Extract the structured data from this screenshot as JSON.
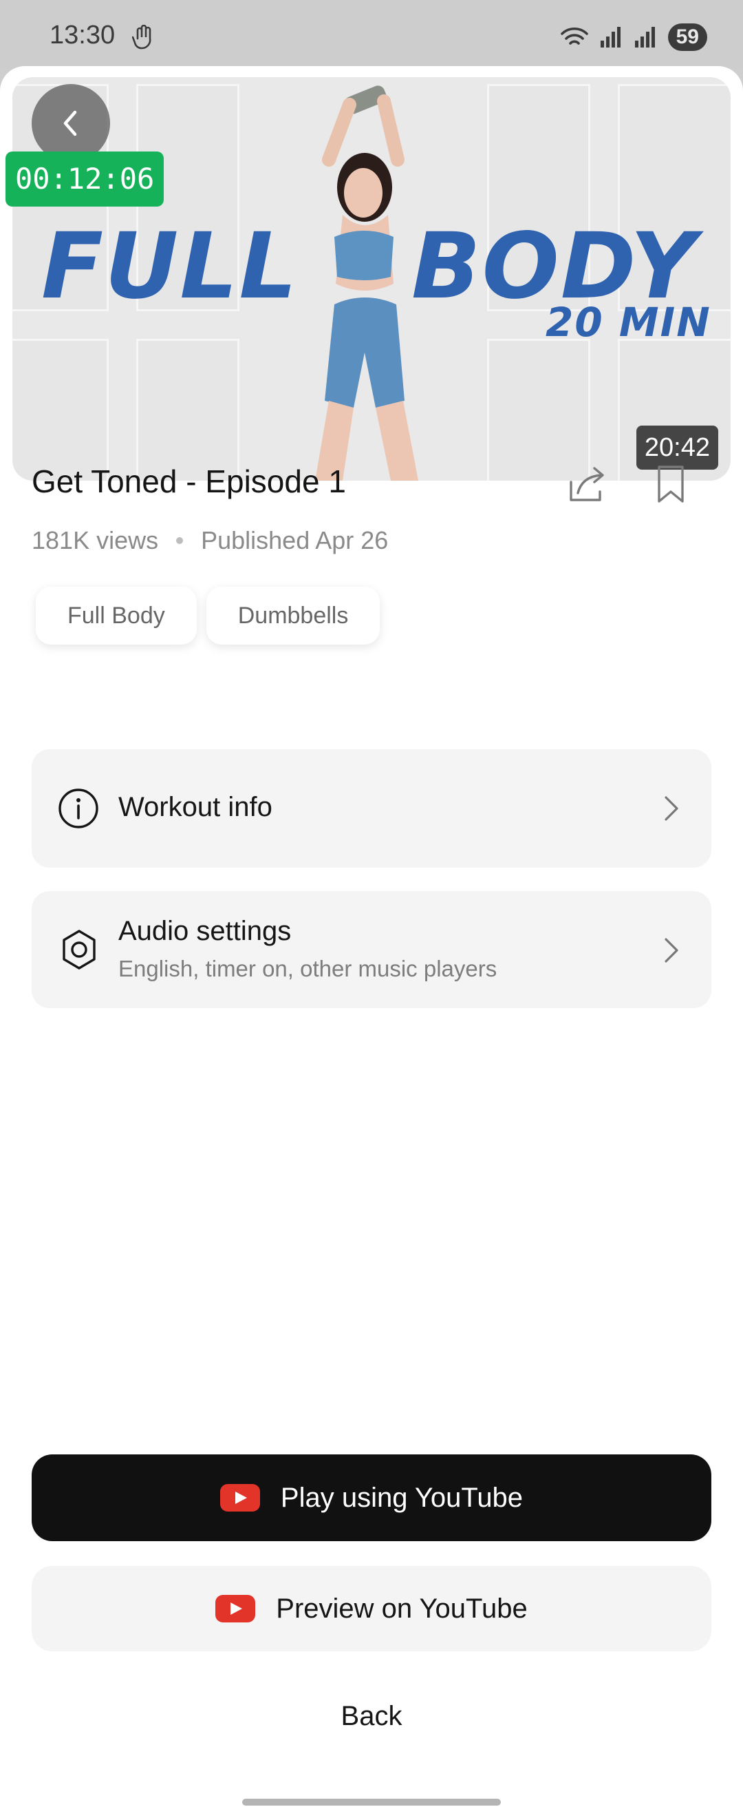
{
  "status": {
    "time": "13:30",
    "battery": "59",
    "icons": [
      "hand-icon",
      "wifi-icon",
      "signal-icon",
      "signal-icon"
    ]
  },
  "video": {
    "thumbnail_words": [
      "FULL",
      "BODY",
      "20 MIN"
    ],
    "timer": "00:12:06",
    "duration": "20:42"
  },
  "details": {
    "title": "Get Toned - Episode 1",
    "views": "181K views",
    "published": "Published Apr 26",
    "tags": [
      "Full Body",
      "Dumbbells"
    ]
  },
  "rows": {
    "workout_info": {
      "label": "Workout info",
      "icon": "info-icon"
    },
    "audio_settings": {
      "label": "Audio settings",
      "sub": "English, timer on, other music players",
      "icon": "gear-icon"
    }
  },
  "actions": {
    "play": "Play using YouTube",
    "preview": "Preview on YouTube",
    "back": "Back"
  },
  "colors": {
    "accent_green": "#16b25a",
    "youtube_red": "#e3342a",
    "thumbnail_blue": "#2f63b0"
  }
}
